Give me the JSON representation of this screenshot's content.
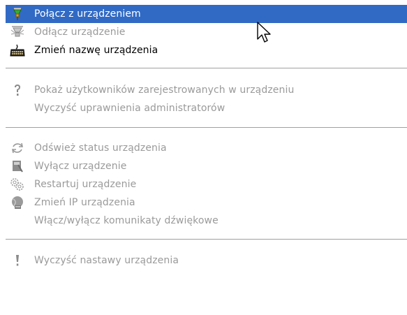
{
  "menu": {
    "items": [
      {
        "label": "Połącz  z urządzeniem",
        "icon": "connect-icon",
        "state": "highlighted"
      },
      {
        "label": "Odłącz urządzenie",
        "icon": "disconnect-icon",
        "state": "disabled"
      },
      {
        "label": "Zmień nazwę urządzenia",
        "icon": "keyboard-icon",
        "state": "enabled"
      },
      {
        "label": "Pokaż użytkowników zarejestrowanych  w urządzeniu",
        "icon": "question-icon",
        "state": "disabled"
      },
      {
        "label": "Wyczyść uprawnienia administratorów",
        "icon": "",
        "state": "disabled"
      },
      {
        "label": "Odśwież status urządzenia",
        "icon": "refresh-icon",
        "state": "disabled"
      },
      {
        "label": "Wyłącz urządzenie",
        "icon": "power-off-icon",
        "state": "disabled"
      },
      {
        "label": "Restartuj urządzenie",
        "icon": "restart-gears-icon",
        "state": "disabled"
      },
      {
        "label": "Zmień IP urządzenia",
        "icon": "globe-network-icon",
        "state": "disabled"
      },
      {
        "label": "Włącz/wyłącz komunikaty dźwiękowe",
        "icon": "",
        "state": "disabled"
      },
      {
        "label": "Wyczyść nastawy urządzenia",
        "icon": "exclamation-icon",
        "state": "disabled"
      }
    ]
  },
  "colors": {
    "highlight": "#316ac5",
    "highlight_text": "#ffffff",
    "disabled_text": "#9a9a9a",
    "enabled_text": "#000000",
    "separator": "#a0a0a0"
  }
}
